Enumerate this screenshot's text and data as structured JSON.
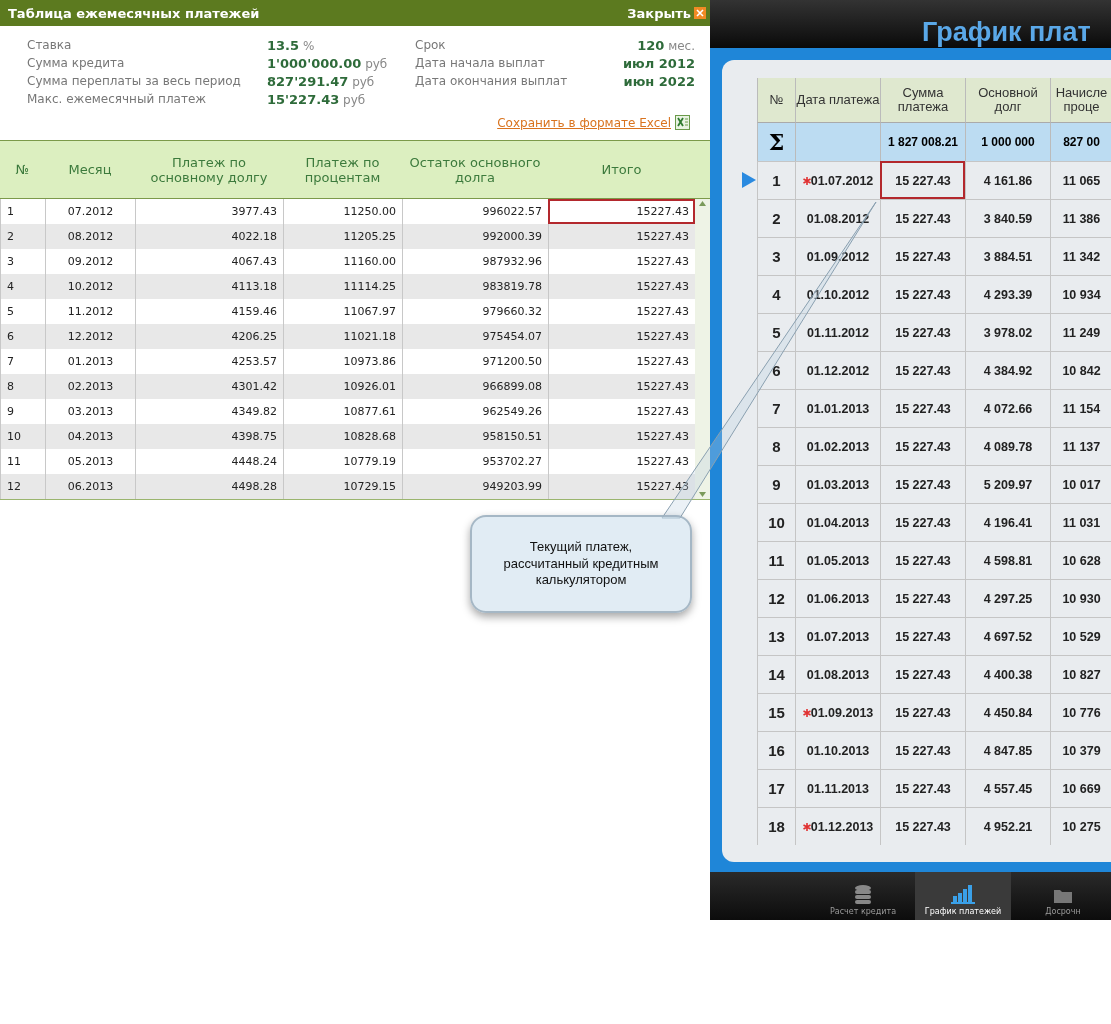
{
  "loan_table": {
    "title": "Таблица ежемесячных платежей",
    "close": "Закрыть",
    "summary_left": [
      {
        "label": "Ставка",
        "value": "13.5",
        "unit": "%"
      },
      {
        "label": "Сумма кредита",
        "value": "1'000'000.00",
        "unit": "руб"
      },
      {
        "label": "Сумма переплаты за весь период",
        "value": "827'291.47",
        "unit": "руб"
      },
      {
        "label": "Макс. ежемесячный платеж",
        "value": "15'227.43",
        "unit": "руб"
      }
    ],
    "summary_right": [
      {
        "label": "Срок",
        "value": "120",
        "unit": "мес."
      },
      {
        "label": "Дата начала выплат",
        "value": "июл 2012"
      },
      {
        "label": "Дата окончания выплат",
        "value": "июн 2022"
      }
    ],
    "excel_link": "Сохранить в формате Excel",
    "columns": [
      "№",
      "Месяц",
      "Платеж по основному долгу",
      "Платеж по процентам",
      "Остаток основного долга",
      "Итого"
    ],
    "rows": [
      {
        "cells": [
          "1",
          "07.2012",
          "3977.43",
          "11250.00",
          "996022.57",
          "15227.43"
        ],
        "highlighted": true
      },
      {
        "cells": [
          "2",
          "08.2012",
          "4022.18",
          "11205.25",
          "992000.39",
          "15227.43"
        ],
        "highlighted": false
      },
      {
        "cells": [
          "3",
          "09.2012",
          "4067.43",
          "11160.00",
          "987932.96",
          "15227.43"
        ],
        "highlighted": false
      },
      {
        "cells": [
          "4",
          "10.2012",
          "4113.18",
          "11114.25",
          "983819.78",
          "15227.43"
        ],
        "highlighted": false
      },
      {
        "cells": [
          "5",
          "11.2012",
          "4159.46",
          "11067.97",
          "979660.32",
          "15227.43"
        ],
        "highlighted": false
      },
      {
        "cells": [
          "6",
          "12.2012",
          "4206.25",
          "11021.18",
          "975454.07",
          "15227.43"
        ],
        "highlighted": false
      },
      {
        "cells": [
          "7",
          "01.2013",
          "4253.57",
          "10973.86",
          "971200.50",
          "15227.43"
        ],
        "highlighted": false
      },
      {
        "cells": [
          "8",
          "02.2013",
          "4301.42",
          "10926.01",
          "966899.08",
          "15227.43"
        ],
        "highlighted": false
      },
      {
        "cells": [
          "9",
          "03.2013",
          "4349.82",
          "10877.61",
          "962549.26",
          "15227.43"
        ],
        "highlighted": false
      },
      {
        "cells": [
          "10",
          "04.2013",
          "4398.75",
          "10828.68",
          "958150.51",
          "15227.43"
        ],
        "highlighted": false
      },
      {
        "cells": [
          "11",
          "05.2013",
          "4448.24",
          "10779.19",
          "953702.27",
          "15227.43"
        ],
        "highlighted": false
      },
      {
        "cells": [
          "12",
          "06.2013",
          "4498.28",
          "10729.15",
          "949203.99",
          "15227.43"
        ],
        "highlighted": false
      }
    ]
  },
  "app": {
    "title": "График плат",
    "columns": [
      "№",
      "Дата платежа",
      "Сумма платежа",
      "Основной долг",
      "Начисле проце"
    ],
    "total": {
      "symbol": "Σ",
      "sum": "1 827 008.21",
      "principal": "1 000 000",
      "interest": "827 00"
    },
    "rows": [
      {
        "number": "1",
        "date": "01.07.2012",
        "marked": true,
        "current": true,
        "highlighted": true,
        "sum": "15 227.43",
        "principal": "4 161.86",
        "interest": "11 065"
      },
      {
        "number": "2",
        "date": "01.08.2012",
        "marked": false,
        "current": false,
        "highlighted": false,
        "sum": "15 227.43",
        "principal": "3 840.59",
        "interest": "11 386"
      },
      {
        "number": "3",
        "date": "01.09.2012",
        "marked": false,
        "current": false,
        "highlighted": false,
        "sum": "15 227.43",
        "principal": "3 884.51",
        "interest": "11 342"
      },
      {
        "number": "4",
        "date": "01.10.2012",
        "marked": false,
        "current": false,
        "highlighted": false,
        "sum": "15 227.43",
        "principal": "4 293.39",
        "interest": "10 934"
      },
      {
        "number": "5",
        "date": "01.11.2012",
        "marked": false,
        "current": false,
        "highlighted": false,
        "sum": "15 227.43",
        "principal": "3 978.02",
        "interest": "11 249"
      },
      {
        "number": "6",
        "date": "01.12.2012",
        "marked": false,
        "current": false,
        "highlighted": false,
        "sum": "15 227.43",
        "principal": "4 384.92",
        "interest": "10 842"
      },
      {
        "number": "7",
        "date": "01.01.2013",
        "marked": false,
        "current": false,
        "highlighted": false,
        "sum": "15 227.43",
        "principal": "4 072.66",
        "interest": "11 154"
      },
      {
        "number": "8",
        "date": "01.02.2013",
        "marked": false,
        "current": false,
        "highlighted": false,
        "sum": "15 227.43",
        "principal": "4 089.78",
        "interest": "11 137"
      },
      {
        "number": "9",
        "date": "01.03.2013",
        "marked": false,
        "current": false,
        "highlighted": false,
        "sum": "15 227.43",
        "principal": "5 209.97",
        "interest": "10 017"
      },
      {
        "number": "10",
        "date": "01.04.2013",
        "marked": false,
        "current": false,
        "highlighted": false,
        "sum": "15 227.43",
        "principal": "4 196.41",
        "interest": "11 031"
      },
      {
        "number": "11",
        "date": "01.05.2013",
        "marked": false,
        "current": false,
        "highlighted": false,
        "sum": "15 227.43",
        "principal": "4 598.81",
        "interest": "10 628"
      },
      {
        "number": "12",
        "date": "01.06.2013",
        "marked": false,
        "current": false,
        "highlighted": false,
        "sum": "15 227.43",
        "principal": "4 297.25",
        "interest": "10 930"
      },
      {
        "number": "13",
        "date": "01.07.2013",
        "marked": false,
        "current": false,
        "highlighted": false,
        "sum": "15 227.43",
        "principal": "4 697.52",
        "interest": "10 529"
      },
      {
        "number": "14",
        "date": "01.08.2013",
        "marked": false,
        "current": false,
        "highlighted": false,
        "sum": "15 227.43",
        "principal": "4 400.38",
        "interest": "10 827"
      },
      {
        "number": "15",
        "date": "01.09.2013",
        "marked": true,
        "current": false,
        "highlighted": false,
        "sum": "15 227.43",
        "principal": "4 450.84",
        "interest": "10 776"
      },
      {
        "number": "16",
        "date": "01.10.2013",
        "marked": false,
        "current": false,
        "highlighted": false,
        "sum": "15 227.43",
        "principal": "4 847.85",
        "interest": "10 379"
      },
      {
        "number": "17",
        "date": "01.11.2013",
        "marked": false,
        "current": false,
        "highlighted": false,
        "sum": "15 227.43",
        "principal": "4 557.45",
        "interest": "10 669"
      },
      {
        "number": "18",
        "date": "01.12.2013",
        "marked": true,
        "current": false,
        "highlighted": false,
        "sum": "15 227.43",
        "principal": "4 952.21",
        "interest": "10 275"
      }
    ],
    "tabs": [
      {
        "label": "Расчет кредита",
        "selected": false
      },
      {
        "label": "График платежей",
        "selected": true
      },
      {
        "label": "Досрочн",
        "selected": false
      }
    ]
  },
  "callout": {
    "text": "Текущий платеж, рассчитанный кредитным калькулятором"
  }
}
